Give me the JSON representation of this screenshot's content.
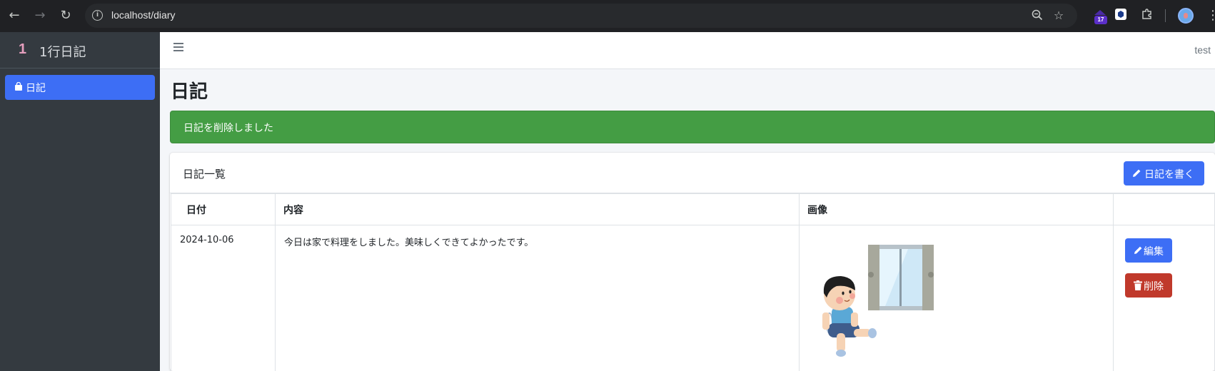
{
  "browser": {
    "url": "localhost/diary",
    "extension_badge": "17",
    "colors": {
      "chrome_bg": "#202124",
      "url_bg": "#282a2d"
    }
  },
  "sidebar": {
    "brand_logo": "1",
    "brand_text": "1行日記",
    "items": [
      {
        "label": "日記",
        "icon": "shopping-bag-icon",
        "active": true
      }
    ]
  },
  "topbar": {
    "user": "test"
  },
  "page": {
    "title": "日記",
    "alert": "日記を削除しました",
    "card_title": "日記一覧",
    "write_button": "日記を書く"
  },
  "table": {
    "headers": [
      "日付",
      "内容",
      "画像",
      ""
    ],
    "rows": [
      {
        "date": "2024-10-06",
        "content": "今日は家で料理をしました。美味しくできてよかったです。",
        "image": "boy-sitting-by-window-illustration",
        "edit_label": "編集",
        "delete_label": "削除"
      }
    ]
  },
  "colors": {
    "primary": "#3d6ef5",
    "success": "#449d44",
    "danger": "#c0392b",
    "sidebar": "#343a40"
  }
}
